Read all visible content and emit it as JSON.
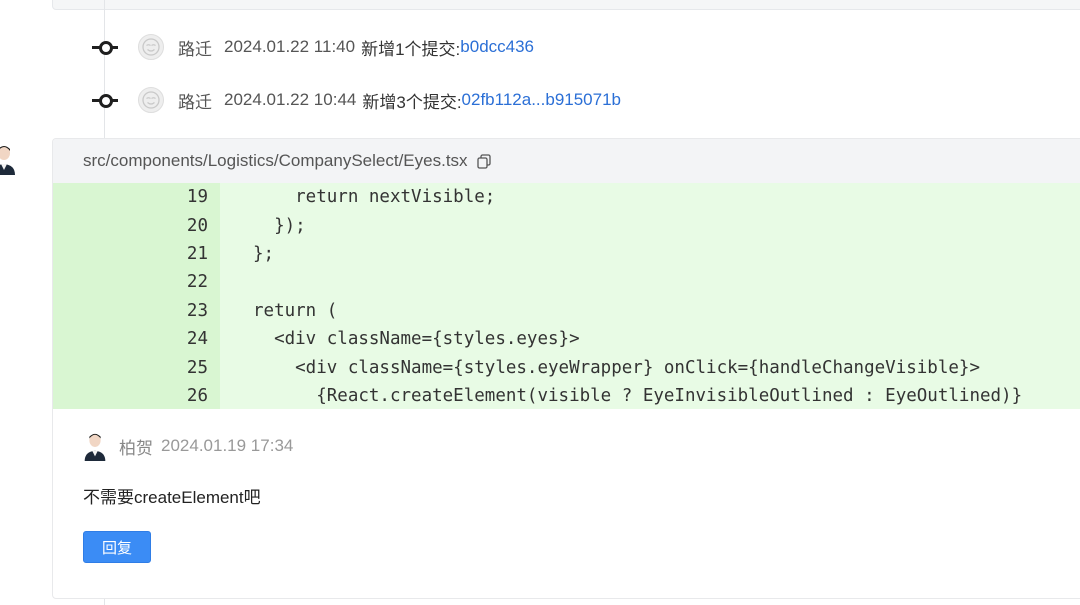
{
  "commits": [
    {
      "author": "路迁",
      "time": "2024.01.22 11:40",
      "message": "新增1个提交:",
      "link": "b0dcc436"
    },
    {
      "author": "路迁",
      "time": "2024.01.22 10:44",
      "message": "新增3个提交:",
      "link": "02fb112a...b915071b"
    }
  ],
  "diff": {
    "file_path": "src/components/Logistics/CompanySelect/Eyes.tsx",
    "lines": [
      {
        "num": "19",
        "code": "    return nextVisible;"
      },
      {
        "num": "20",
        "code": "  });"
      },
      {
        "num": "21",
        "code": "};"
      },
      {
        "num": "22",
        "code": ""
      },
      {
        "num": "23",
        "code": "return ("
      },
      {
        "num": "24",
        "code": "  <div className={styles.eyes}>"
      },
      {
        "num": "25",
        "code": "    <div className={styles.eyeWrapper} onClick={handleChangeVisible}>"
      },
      {
        "num": "26",
        "code": "      {React.createElement(visible ? EyeInvisibleOutlined : EyeOutlined)}"
      }
    ]
  },
  "comment": {
    "author": "柏贺",
    "time": "2024.01.19 17:34",
    "body": "不需要createElement吧",
    "reply_label": "回复"
  },
  "colors": {
    "link": "#2b6fd6",
    "added_bg": "#e8fbe5",
    "gutter_bg": "#d9f6d2",
    "button": "#3b8cf5"
  }
}
